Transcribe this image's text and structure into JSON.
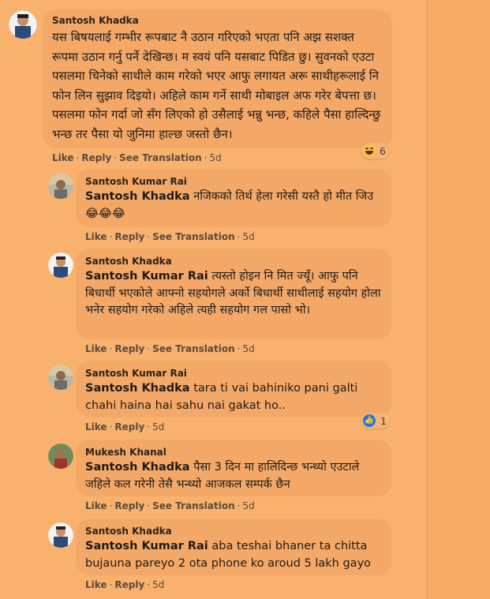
{
  "comments": [
    {
      "author": "Santosh Khadka",
      "text": "यस बिषयलाई गम्भीर रूपबाट नै उठान गरिएको भएता पनि अझ सशक्त रूपमा उठान गर्नु पर्ने देखिन्छ। म स्वयं पनि यसबाट पिडित छु। सुवनको एउटा पसलमा चिनेको साथीले काम गरेको भएर आफु लगायत अरू साथीहरूलाई नि फोन लिन सुझाव दिइयो। अहिले काम गर्ने साथी मोबाइल अफ गरेर बेपत्ता छ। पसलमा फोन गर्दा जो सँग लिएको हो उसैलाई भन्नु भन्छ, कहिले पैसा हाल्दिन्छु भन्छ तर पैसा यो जुनिमा हाल्छ जस्तो छैन।",
      "like": "Like",
      "reply": "Reply",
      "translate": "See Translation",
      "time": "5d",
      "reaction_count": "6"
    },
    {
      "author": "Santosh Kumar Rai",
      "mention": "Santosh Khadka",
      "text": " नजिकको तिर्थ हेला गरेसी यस्तै हो मीत जिउ😂😂😂",
      "like": "Like",
      "reply": "Reply",
      "translate": "See Translation",
      "time": "5d"
    },
    {
      "author": "Santosh Khadka",
      "mention": "Santosh Kumar Rai",
      "text": " त्यस्तो होइन नि मित ज्यूँ। आफु पनि बिधार्थी भएकोले आफ्नो सहयोगले अर्को बिधार्थी साथीलाई सहयोग होला भनेर सहयोग गरेको अहिले त्यही सहयोग गल पासो भो।",
      "like": "Like",
      "reply": "Reply",
      "translate": "See Translation",
      "time": "5d"
    },
    {
      "author": "Santosh Kumar Rai",
      "mention": "Santosh Khadka",
      "text": " tara ti vai bahiniko pani galti chahi haina hai sahu nai gakat ho..",
      "like": "Like",
      "reply": "Reply",
      "time": "5d",
      "reaction_count": "1"
    },
    {
      "author": "Mukesh Khanal",
      "mention": "Santosh Khadka",
      "text": " पैसा 3 दिन मा हालिदिन्छ भन्थ्यो एउटाले जहिले कल गरेनी तेसै भन्थ्यो आजकल सम्पर्क छैन",
      "like": "Like",
      "reply": "Reply",
      "translate": "See Translation",
      "time": "5d"
    },
    {
      "author": "Santosh Khadka",
      "mention": "Santosh Kumar Rai",
      "text": " aba teshai bhaner ta chitta bujauna pareyo 2 ota phone ko aroud 5 lakh gayo",
      "like": "Like",
      "reply": "Reply",
      "time": "5d"
    }
  ],
  "colors": {
    "background": "#f9b16e",
    "bubble": "#f4a867",
    "like_blue": "#1877f2"
  },
  "icons": [
    "haha-reaction-icon",
    "like-reaction-icon"
  ]
}
